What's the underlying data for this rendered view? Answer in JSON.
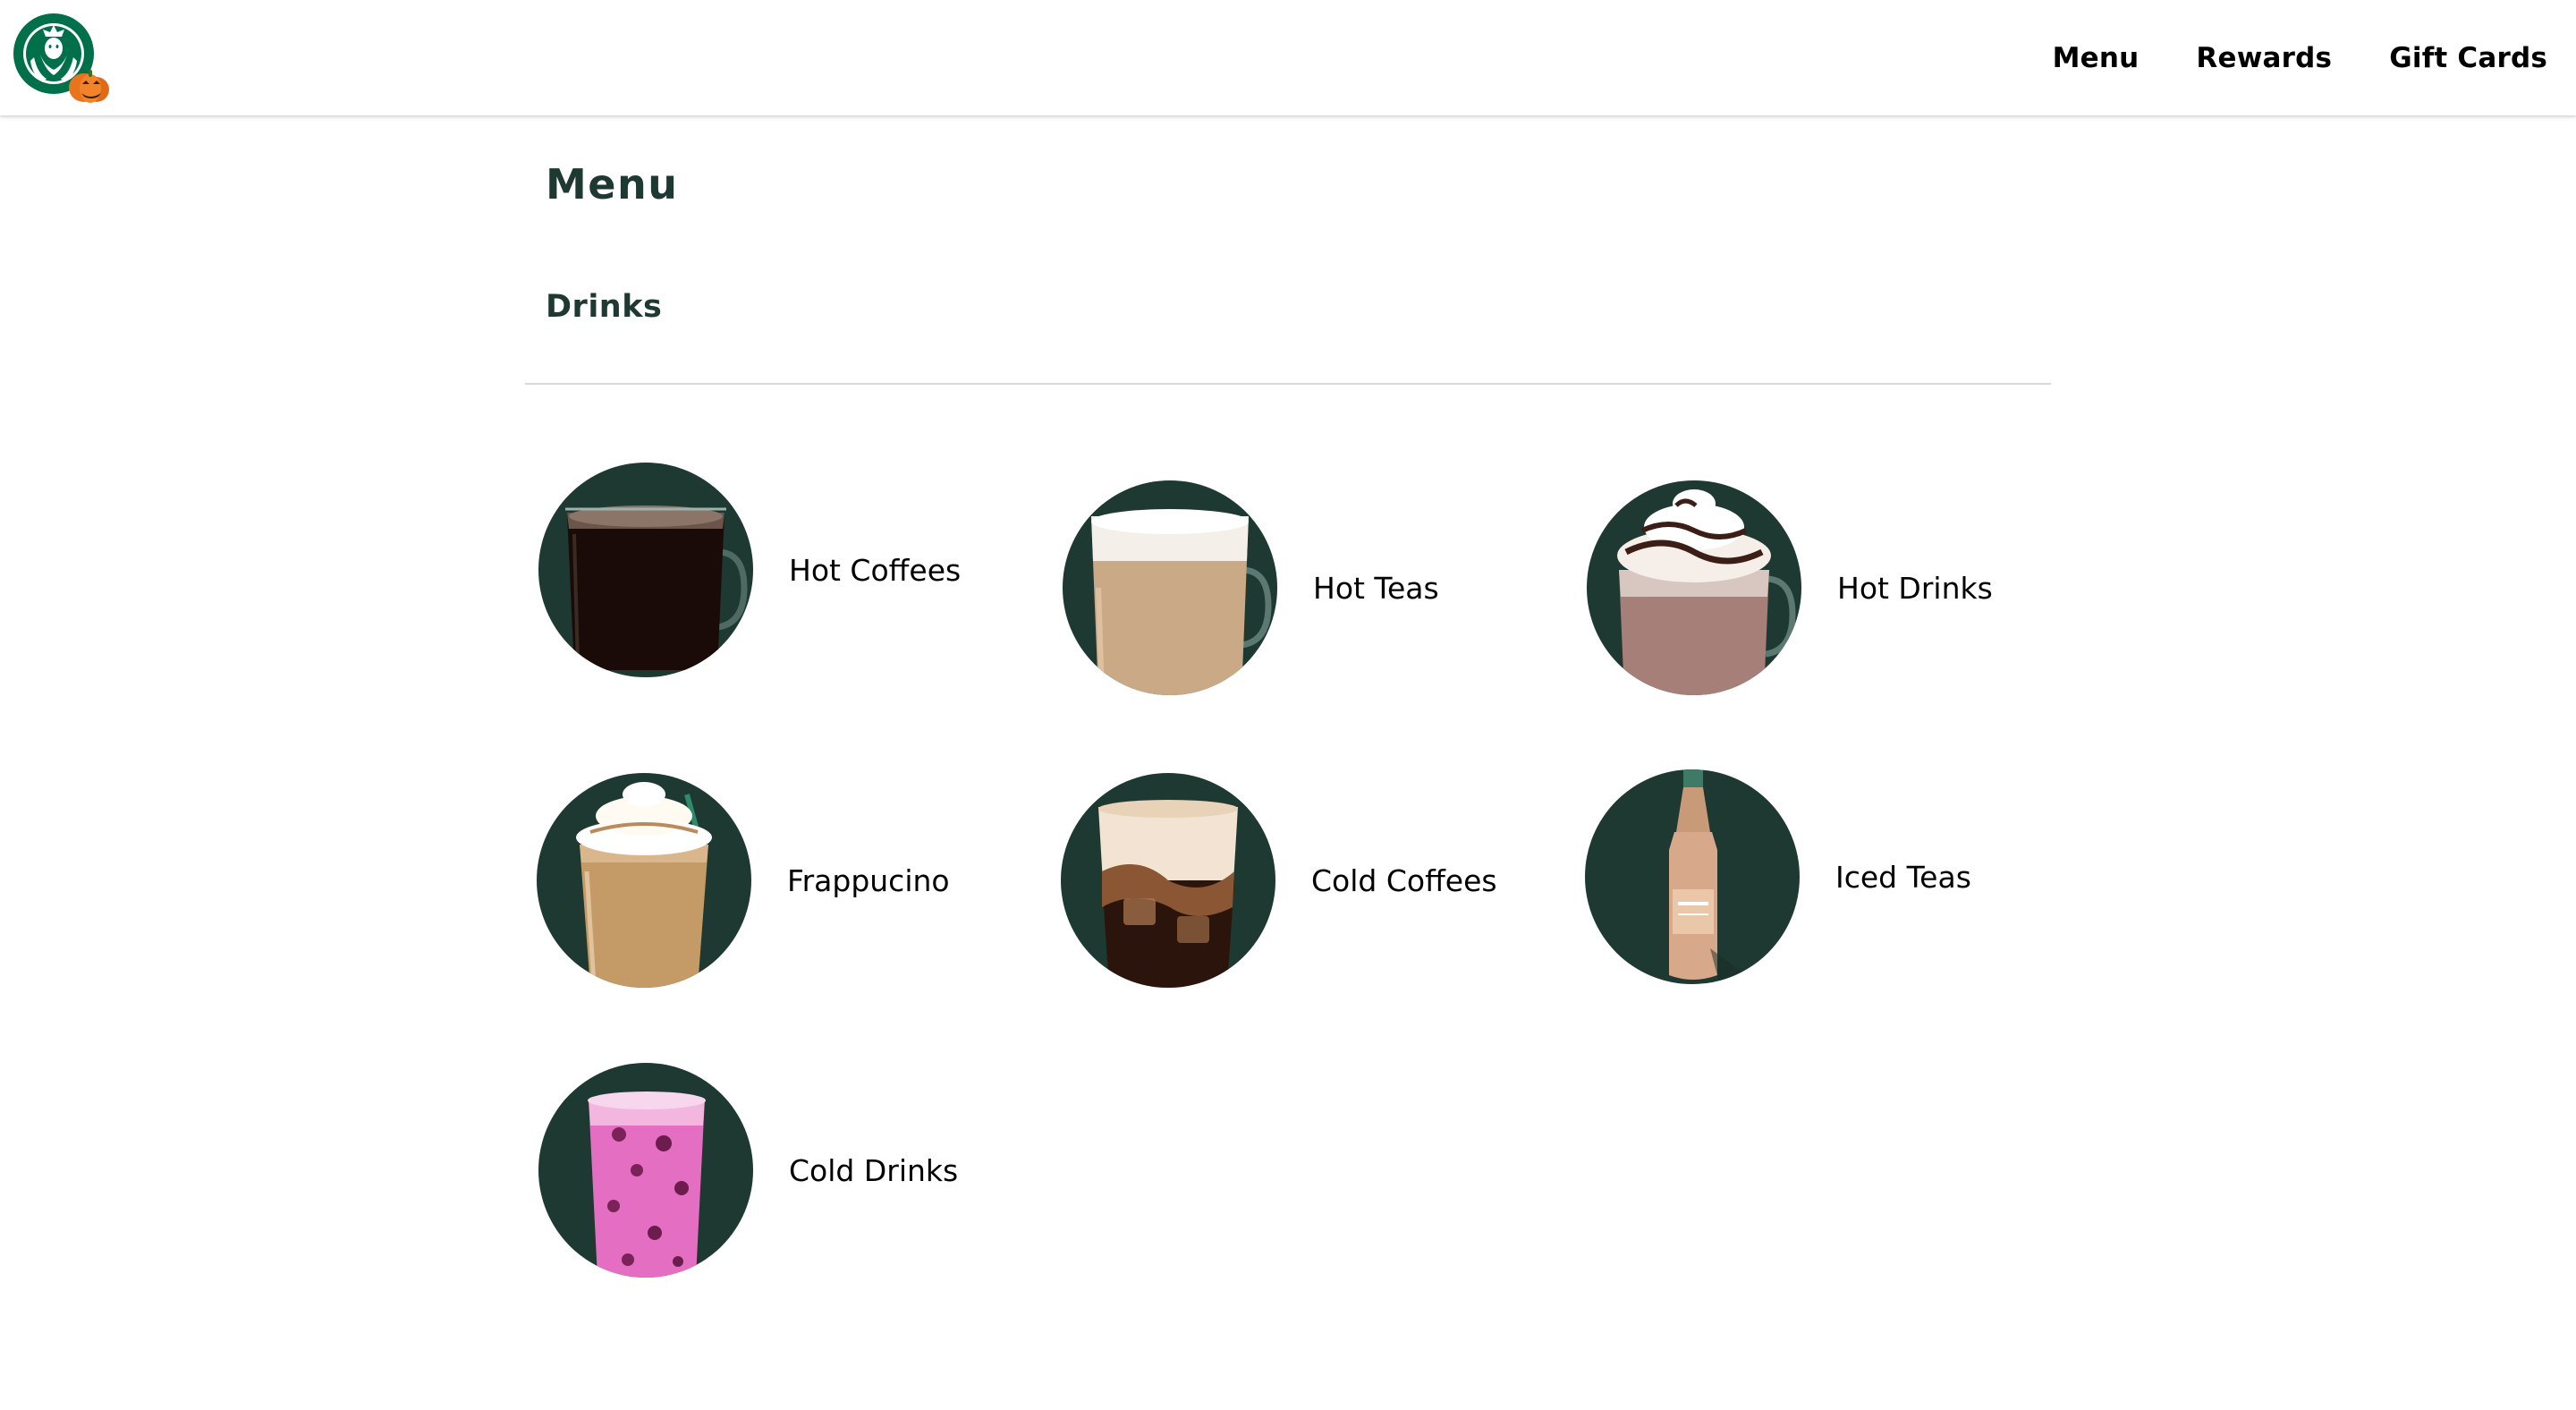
{
  "header": {
    "logo_icon": "starbucks-siren-logo-with-pumpkin",
    "nav": [
      {
        "label": "Menu"
      },
      {
        "label": "Rewards"
      },
      {
        "label": "Gift Cards"
      }
    ]
  },
  "main": {
    "title": "Menu",
    "section_title": "Drinks",
    "categories": [
      {
        "label": "Hot Coffees",
        "icon": "hot-coffee-mug-icon"
      },
      {
        "label": "Hot Teas",
        "icon": "hot-tea-latte-mug-icon"
      },
      {
        "label": "Hot Drinks",
        "icon": "hot-chocolate-mug-icon"
      },
      {
        "label": "Frappucino",
        "icon": "frappuccino-cup-icon"
      },
      {
        "label": "Cold Coffees",
        "icon": "iced-coffee-cup-icon"
      },
      {
        "label": "Iced Teas",
        "icon": "iced-tea-bottle-icon"
      },
      {
        "label": "Cold Drinks",
        "icon": "pink-cold-drink-cup-icon"
      }
    ]
  },
  "colors": {
    "brand_green": "#1e3932",
    "logo_green": "#00704a",
    "pumpkin_orange": "#e8741c",
    "divider": "#d9d9d9"
  }
}
